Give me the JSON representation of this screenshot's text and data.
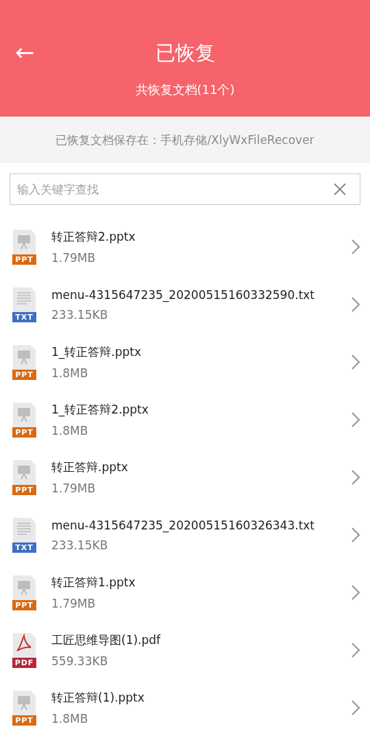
{
  "header": {
    "back_icon": "←",
    "title": "已恢复",
    "subtitle": "共恢复文档(11个)"
  },
  "save_path": "已恢复文档保存在：手机存储/XlyWxFileRecover",
  "search": {
    "placeholder": "输入关键字查找"
  },
  "files": [
    {
      "kind": "ppt",
      "badge": "PPT",
      "name": "转正答辩2.pptx",
      "size": "1.79MB"
    },
    {
      "kind": "txt",
      "badge": "TXT",
      "name": "menu-4315647235_20200515160332590.txt",
      "size": "233.15KB"
    },
    {
      "kind": "ppt",
      "badge": "PPT",
      "name": "1_转正答辩.pptx",
      "size": "1.8MB"
    },
    {
      "kind": "ppt",
      "badge": "PPT",
      "name": "1_转正答辩2.pptx",
      "size": "1.8MB"
    },
    {
      "kind": "ppt",
      "badge": "PPT",
      "name": "转正答辩.pptx",
      "size": "1.79MB"
    },
    {
      "kind": "txt",
      "badge": "TXT",
      "name": "menu-4315647235_20200515160326343.txt",
      "size": "233.15KB"
    },
    {
      "kind": "ppt",
      "badge": "PPT",
      "name": "转正答辩1.pptx",
      "size": "1.79MB"
    },
    {
      "kind": "pdf",
      "badge": "PDF",
      "name": "工匠思维导图(1).pdf",
      "size": "559.33KB"
    },
    {
      "kind": "ppt",
      "badge": "PPT",
      "name": "转正答辩(1).pptx",
      "size": "1.8MB"
    }
  ]
}
